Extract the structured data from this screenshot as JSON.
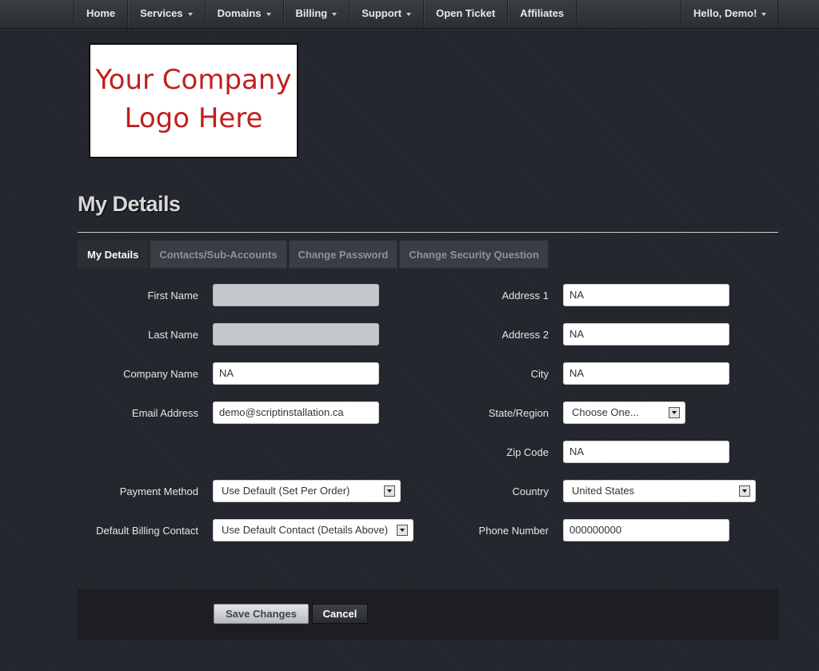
{
  "nav": {
    "items": [
      {
        "label": "Home",
        "dropdown": false
      },
      {
        "label": "Services",
        "dropdown": true
      },
      {
        "label": "Domains",
        "dropdown": true
      },
      {
        "label": "Billing",
        "dropdown": true
      },
      {
        "label": "Support",
        "dropdown": true
      },
      {
        "label": "Open Ticket",
        "dropdown": false
      },
      {
        "label": "Affiliates",
        "dropdown": false
      }
    ],
    "user_label": "Hello, Demo!"
  },
  "logo": {
    "line1": "Your Company",
    "line2": "Logo Here"
  },
  "page_title": "My Details",
  "tabs": [
    {
      "label": "My Details",
      "active": true
    },
    {
      "label": "Contacts/Sub-Accounts",
      "active": false
    },
    {
      "label": "Change Password",
      "active": false
    },
    {
      "label": "Change Security Question",
      "active": false
    }
  ],
  "form": {
    "first_name": {
      "label": "First Name",
      "value": ""
    },
    "last_name": {
      "label": "Last Name",
      "value": ""
    },
    "company_name": {
      "label": "Company Name",
      "value": "NA"
    },
    "email": {
      "label": "Email Address",
      "value": "demo@scriptinstallation.ca"
    },
    "payment_method": {
      "label": "Payment Method",
      "value": "Use Default (Set Per Order)"
    },
    "billing_contact": {
      "label": "Default Billing Contact",
      "value": "Use Default Contact (Details Above)"
    },
    "address1": {
      "label": "Address 1",
      "value": "NA"
    },
    "address2": {
      "label": "Address 2",
      "value": "NA"
    },
    "city": {
      "label": "City",
      "value": "NA"
    },
    "state": {
      "label": "State/Region",
      "value": "Choose One..."
    },
    "zip": {
      "label": "Zip Code",
      "value": "NA"
    },
    "country": {
      "label": "Country",
      "value": "United States"
    },
    "phone": {
      "label": "Phone Number",
      "value": "000000000"
    }
  },
  "actions": {
    "save": "Save Changes",
    "cancel": "Cancel"
  },
  "colors": {
    "background": "#23262c",
    "logo_text": "#c11f1f",
    "disabled_input": "#c4c7cb"
  }
}
